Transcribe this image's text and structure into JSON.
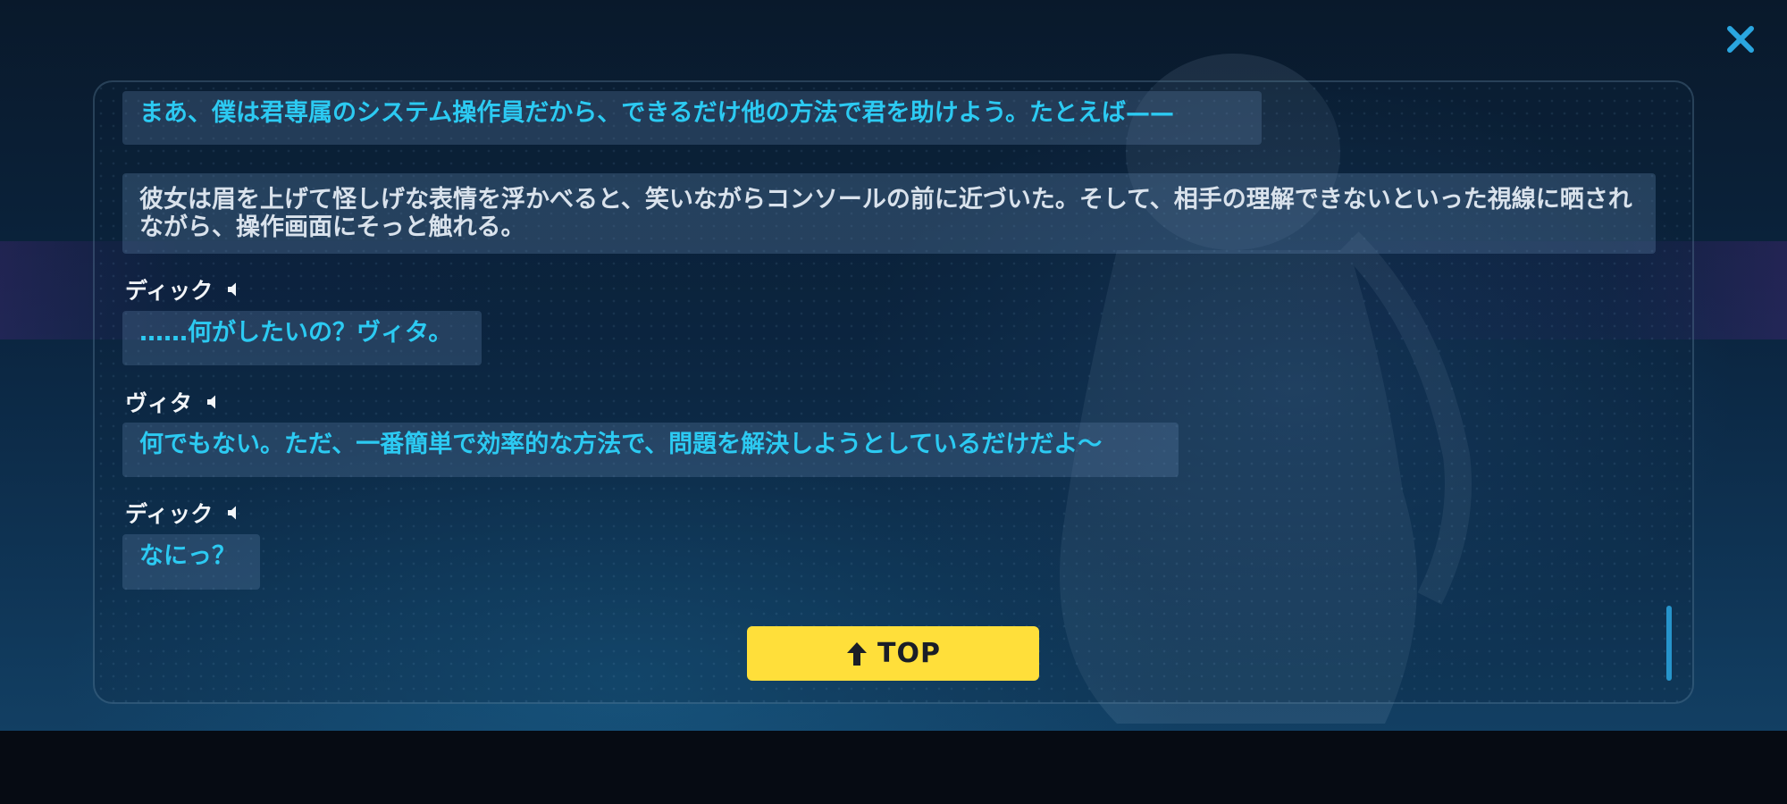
{
  "colors": {
    "dialogue_text": "#2ccaf2",
    "narration_text": "#d9e2ec",
    "speaker_text": "#f2f5f8",
    "top_button_bg": "#ffdf3a",
    "top_button_text": "#1a1e27",
    "close_icon": "#2aa6e0"
  },
  "icons": {
    "close": "close-icon",
    "voice": "speaker-icon",
    "top_arrow": "arrow-up-icon"
  },
  "log": {
    "entries": [
      {
        "type": "dialogue",
        "text": "まあ、僕は君専属のシステム操作員だから、できるだけ他の方法で君を助けよう。たとえば——"
      },
      {
        "type": "narration",
        "text": "彼女は眉を上げて怪しげな表情を浮かべると、笑いながらコンソールの前に近づいた。そして、相手の理解できないといった視線に晒されながら、操作画面にそっと触れる。"
      },
      {
        "type": "dialogue",
        "speaker": "ディック",
        "text": "……何がしたいの？ヴィタ。"
      },
      {
        "type": "dialogue",
        "speaker": "ヴィタ",
        "text": "何でもない。ただ、一番簡単で効率的な方法で、問題を解決しようとしているだけだよ～"
      },
      {
        "type": "dialogue",
        "speaker": "ディック",
        "text": "なにっ？"
      }
    ]
  },
  "top_button": {
    "label": "TOP"
  }
}
